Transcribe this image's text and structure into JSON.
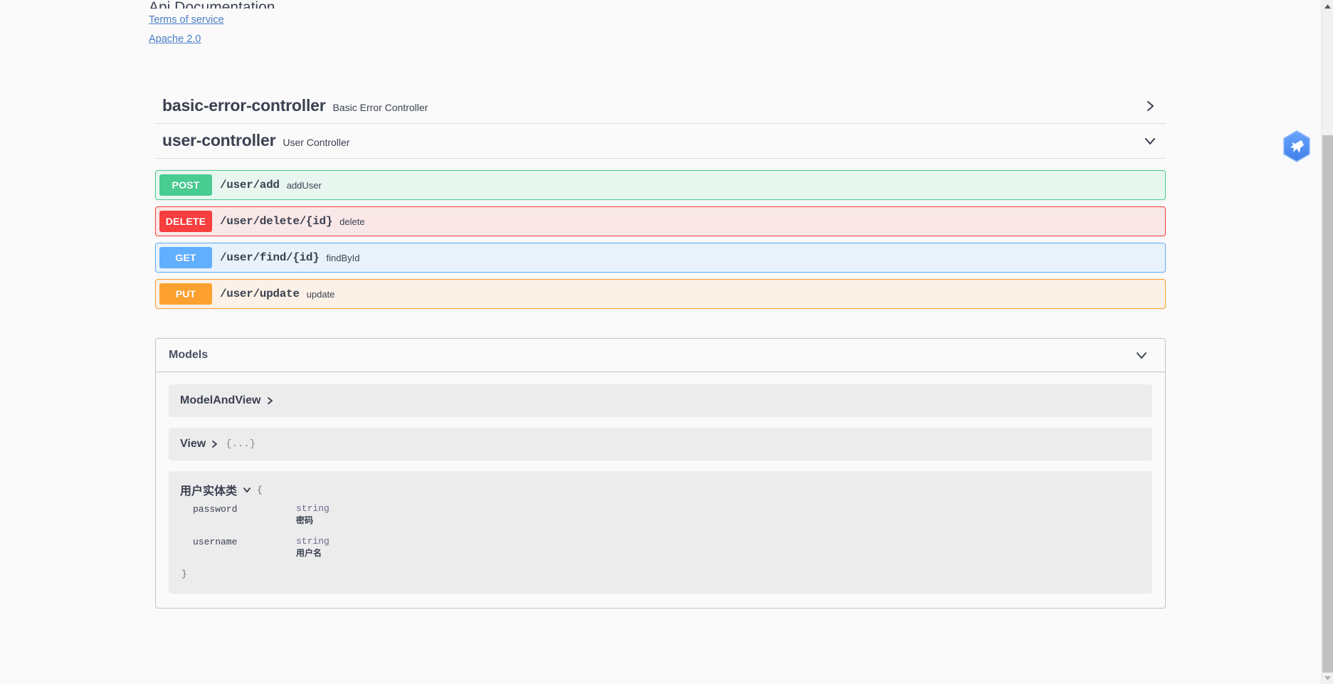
{
  "info": {
    "title": "Api Documentation",
    "terms_link": "Terms of service",
    "license_link": "Apache 2.0"
  },
  "tags": [
    {
      "name": "basic-error-controller",
      "description": "Basic Error Controller",
      "expanded": false,
      "chevron": "chevron-right-icon"
    },
    {
      "name": "user-controller",
      "description": "User Controller",
      "expanded": true,
      "chevron": "chevron-down-icon"
    }
  ],
  "operations": [
    {
      "method": "POST",
      "path": "/user/add",
      "summary": "addUser",
      "color": "#49cc90"
    },
    {
      "method": "DELETE",
      "path": "/user/delete/{id}",
      "summary": "delete",
      "color": "#f93e3e"
    },
    {
      "method": "GET",
      "path": "/user/find/{id}",
      "summary": "findById",
      "color": "#61affe"
    },
    {
      "method": "PUT",
      "path": "/user/update",
      "summary": "update",
      "color": "#fca130"
    }
  ],
  "models": {
    "title": "Models",
    "chevron": "chevron-down-icon",
    "items": [
      {
        "name": "ModelAndView",
        "expanded": false,
        "chevron": "chevron-right-icon",
        "preview": ""
      },
      {
        "name": "View",
        "expanded": false,
        "chevron": "chevron-right-icon",
        "preview": "{...}"
      },
      {
        "name": "用户实体类",
        "expanded": true,
        "chevron": "chevron-down-icon",
        "open_brace": "{",
        "close_brace": "}",
        "properties": [
          {
            "name": "password",
            "type": "string",
            "description": "密码"
          },
          {
            "name": "username",
            "type": "string",
            "description": "用户名"
          }
        ]
      }
    ]
  },
  "extension_badge": {
    "icon": "bird-hexagon-icon",
    "color": "#4a8cf7"
  },
  "scrollbar": {
    "up_arrow": "scroll-up-arrow-icon",
    "down_arrow": "scroll-down-arrow-icon"
  }
}
